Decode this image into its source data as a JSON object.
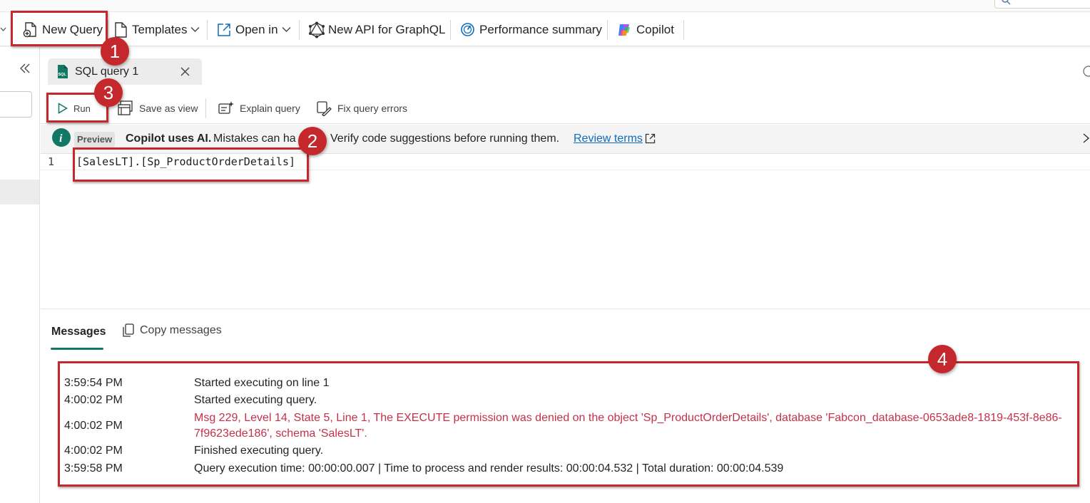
{
  "ribbon": {
    "new_query": "New Query",
    "templates": "Templates",
    "open_in": "Open in",
    "new_api": "New API for GraphQL",
    "performance": "Performance summary",
    "copilot": "Copilot"
  },
  "tab": {
    "label": "SQL query 1",
    "icon_text": "SQL"
  },
  "editor_toolbar": {
    "run": "Run",
    "save_as_view": "Save as view",
    "explain_query": "Explain query",
    "fix_query_errors": "Fix query errors"
  },
  "banner": {
    "badge": "Preview",
    "bold": "Copilot uses AI.",
    "text": "Mistakes can ha",
    "text_after": "Verify code suggestions before running them.",
    "link": "Review terms"
  },
  "editor": {
    "line_number": "1",
    "code": "[SalesLT].[Sp_ProductOrderDetails]"
  },
  "messages": {
    "tab_label": "Messages",
    "copy_label": "Copy messages",
    "rows": [
      {
        "time": "3:59:54 PM",
        "text": "Started executing on line 1"
      },
      {
        "time": "4:00:02 PM",
        "text": "Started executing query."
      },
      {
        "time": "4:00:02 PM",
        "text": "Msg 229, Level 14, State 5, Line 1, The EXECUTE permission was denied on the object 'Sp_ProductOrderDetails', database 'Fabcon_database-0653ade8-1819-453f-8e86-",
        "text2": "7f9623ede186', schema 'SalesLT'."
      },
      {
        "time": "4:00:02 PM",
        "text": "Finished executing query."
      },
      {
        "time": "3:59:58 PM",
        "text": "Query execution time: 00:00:00.007 | Time to process and render results: 00:00:04.532 | Total duration: 00:00:04.539"
      }
    ]
  },
  "annotations": {
    "step1": "1",
    "step2": "2",
    "step3": "3",
    "step4": "4"
  },
  "colors": {
    "accent_red": "#c5282c",
    "error_text": "#c4314b",
    "teal": "#117865"
  }
}
